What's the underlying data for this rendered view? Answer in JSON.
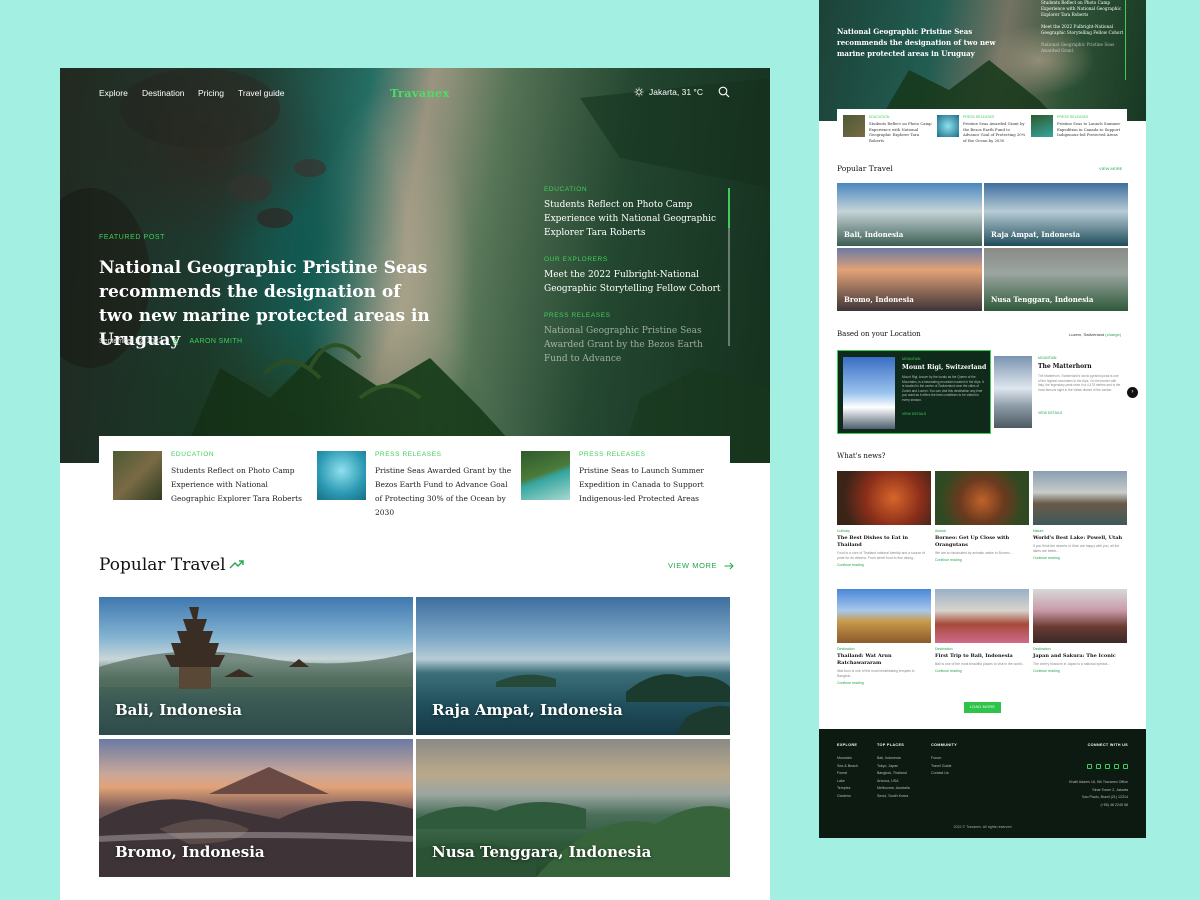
{
  "brand": {
    "logo": "Travanex",
    "accent": "#3ecf5a"
  },
  "nav": {
    "links": [
      "Explore",
      "Destination",
      "Pricing",
      "Travel guide"
    ],
    "weather": "Jakarta, 31 °C"
  },
  "hero": {
    "tag": "FEATURED POST",
    "title": "National Geographic Pristine Seas recommends the designation of two new marine protected areas in Uruguay",
    "date": "September 22, 2022",
    "author": "AARON SMITH",
    "side": [
      {
        "category": "EDUCATION",
        "title": "Students Reflect on Photo Camp Experience with National Geographic Explorer Tara Roberts"
      },
      {
        "category": "OUR EXPLORERS",
        "title": "Meet the 2022 Fulbright-National Geographic Storytelling Fellow Cohort"
      },
      {
        "category": "PRESS RELEASES",
        "title": "National Geographic Pristine Seas Awarded Grant by the Bezos Earth Fund to Advance"
      }
    ]
  },
  "cards": [
    {
      "category": "EDUCATION",
      "title": "Students Reflect on Photo Camp Experience with National Geographic Explorer Tara Roberts"
    },
    {
      "category": "PRESS RELEASES",
      "title": "Pristine Seas Awarded Grant by the Bezos Earth Fund to Advance Goal of Protecting 30% of the Ocean by 2030"
    },
    {
      "category": "PRESS RELEASES",
      "title": "Pristine Seas to Launch Summer Expedition in Canada to Support Indigenous-led Protected Areas"
    }
  ],
  "popular": {
    "title": "Popular Travel",
    "view_more": "VIEW MORE",
    "destinations": [
      "Bali, Indonesia",
      "Raja Ampat, Indonesia",
      "Bromo, Indonesia",
      "Nusa Tenggara, Indonesia"
    ]
  },
  "mini": {
    "hero_title": "National Geographic Pristine Seas recommends the designation of two new marine protected areas in Uruguay",
    "side": [
      {
        "category": "",
        "title": "Students Reflect on Photo Camp Experience with National Geographic Explorer Tara Roberts"
      },
      {
        "category": "",
        "title": "Meet the 2022 Fulbright-National Geographic Storytelling Fellow Cohort"
      },
      {
        "category": "",
        "title": "National Geographic Pristine Seas Awarded Grant"
      }
    ],
    "cards": [
      {
        "category": "EDUCATION",
        "title": "Students Reflect on Photo Camp Experience with National Geographic Explorer Tara Roberts"
      },
      {
        "category": "PRESS RELEASES",
        "title": "Pristine Seas Awarded Grant by the Bezos Earth Fund to Advance Goal of Protecting 30% of the Ocean by 2030"
      },
      {
        "category": "PRESS RELEASES",
        "title": "Pristine Seas to Launch Summer Expedition in Canada to Support Indigenous-led Protected Areas"
      }
    ],
    "popular_title": "Popular Travel",
    "view_more": "VIEW MORE",
    "location_title": "Based on your Location",
    "location_value": "Luzern, Switzerland",
    "location_change": "(change)",
    "location_cards": [
      {
        "category": "MOUNTAIN",
        "title": "Mount Rigi, Switzerland",
        "excerpt": "Mount Rigi, known by the locals as the Queen of the Mountains, is a fascinating mountain located in the Alps. It is located in the centre of Switzerland near the cities of Zurich and Lucern. You can visit this destination any time you want as it offers the best conditions to be visited in every season.",
        "link": "VIEW DETAILS"
      },
      {
        "category": "MOUNTAIN",
        "title": "The Matterhorn",
        "excerpt": "The Matterhorn, Switzerland's iconic pyramid peak is one of the highest mountains in the Alps. On the border with Italy, the legendary peak rises in a 4,478 metres and is the most famous sight in the Valais district of the canton.",
        "link": "VIEW DETAILS"
      }
    ],
    "news_title": "What's news?",
    "news": [
      {
        "category": "Culinary",
        "title": "The Best Dishes to Eat in Thailand",
        "excerpt": "Food is a core of Thailand national identity and a source of pride for its citizens. From street food to fine dining...",
        "more": "Continue reading"
      },
      {
        "category": "Animal",
        "title": "Borneo: Get Up Close with Orangutans",
        "excerpt": "We are so fascinated by animals native to Borneo...",
        "more": "Continue reading"
      },
      {
        "category": "Nature",
        "title": "World's Best Lake: Powell, Utah",
        "excerpt": "If you think the deserts of Utah are happy with you, all the lakes are better...",
        "more": "Continue reading"
      },
      {
        "category": "Destination",
        "title": "Thailand: Wat Arun Ratchawararam",
        "excerpt": "Wat Arun is one of the most breathtaking temples in Bangkok...",
        "more": "Continue reading"
      },
      {
        "category": "Destination",
        "title": "First Trip to Bali, Indonesia",
        "excerpt": "Bali is one of the most beautiful places to visit in the world...",
        "more": "Continue reading"
      },
      {
        "category": "Destination",
        "title": "Japan and Sakura: The Iconic",
        "excerpt": "The cherry blossom in Japan is a national symbol...",
        "more": "Continue reading"
      }
    ],
    "load_more": "LOAD MORE",
    "footer": {
      "explore_h": "EXPLORE",
      "explore": [
        "Mountain",
        "Sea & Beach",
        "Forest",
        "Lake",
        "Temples",
        "Gardens"
      ],
      "top_h": "TOP PLACES",
      "top": [
        "Bali, Indonesia",
        "Tokyo, Japan",
        "Bangkok, Thailand",
        "Arizona, USA",
        "Melbourne, Australia",
        "Seoul, South Korea"
      ],
      "community_h": "COMMUNITY",
      "community": [
        "Forum",
        "Travel Guide",
        "Contact Us"
      ],
      "connect_h": "CONNECT WITH US",
      "address": [
        "Khalil Adams 18, 5th Travanex Office",
        "Sinar Tower 2, Jakarta",
        "Sao Paulo, Brazil (21) 12314",
        "(+55) 48 2245 58"
      ],
      "copyright": "2022 © Travanex. All rights reserved"
    }
  }
}
